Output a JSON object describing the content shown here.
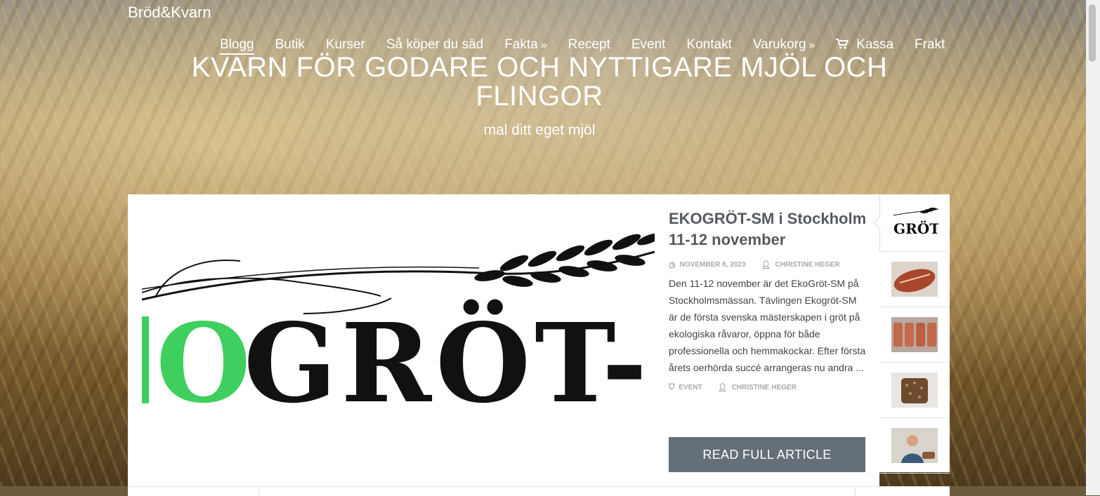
{
  "site": {
    "brand": "Bröd&Kvarn"
  },
  "nav": {
    "items": [
      {
        "label": "Blogg"
      },
      {
        "label": "Butik"
      },
      {
        "label": "Kurser"
      },
      {
        "label": "Så köper du säd"
      },
      {
        "label": "Fakta"
      },
      {
        "label": "Recept"
      },
      {
        "label": "Event"
      },
      {
        "label": "Kontakt"
      },
      {
        "label": "Varukorg"
      },
      {
        "label": "Kassa"
      },
      {
        "label": "Frakt"
      }
    ],
    "active": "Blogg",
    "dropdown_icon": "double-chevron-right-icon",
    "cart_icon": "shopping-cart-icon"
  },
  "hero": {
    "title": "KVARN FÖR GODARE OCH NYTTIGARE MJÖL OCH FLINGOR",
    "subtitle": "mal ditt eget mjöl"
  },
  "featured": {
    "image_text_green": "O",
    "image_text_black": "GRÖT-S",
    "title": "EKOGRÖT-SM i Stockholm 11-12 november",
    "date": "NOVEMBER 8, 2023",
    "author": "CHRISTINE HEGER",
    "excerpt": "Den 11-12 november är det EkoGröt-SM på Stockholmsmässan. Tävlingen Ekogröt-SM är de första svenska mästerskapen i gröt på ekologiska råvaror, öppna för både professionella och hemmakockar. Efter första årets oerhörda succé arrangeras nu andra ...",
    "category": "EVENT",
    "author2": "CHRISTINE HEGER",
    "read_more": "READ FULL ARTICLE"
  },
  "thumbnails": {
    "first_label": "GRÖT"
  },
  "colors": {
    "button_bg": "#646f78",
    "title_text": "#555a60",
    "green_accent": "#3fcf5f"
  }
}
